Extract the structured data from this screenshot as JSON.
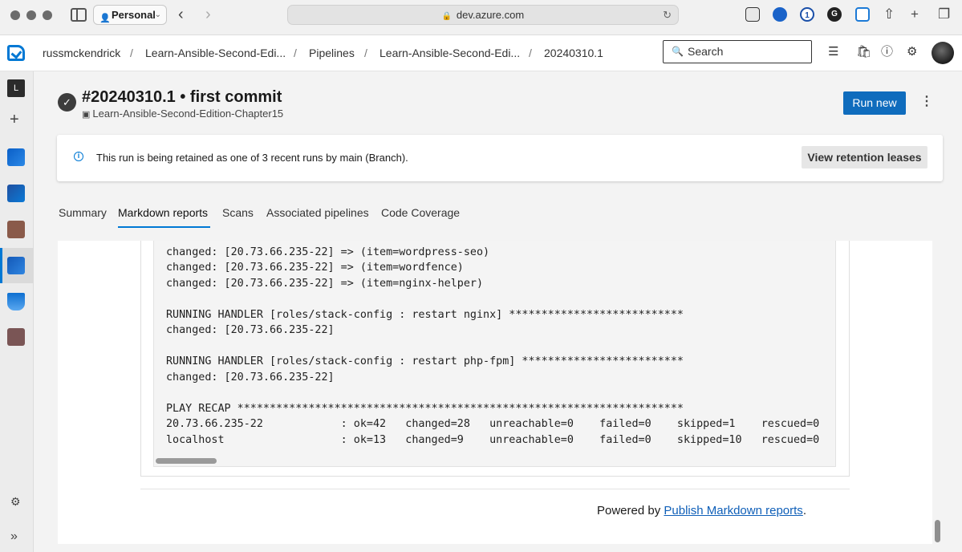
{
  "browser": {
    "profile": "Personal",
    "url": "dev.azure.com"
  },
  "header": {
    "breadcrumbs": [
      "russmckendrick",
      "Learn-Ansible-Second-Edi...",
      "Pipelines",
      "Learn-Ansible-Second-Edi...",
      "20240310.1"
    ],
    "separator": "/",
    "search_placeholder": "Search"
  },
  "left_nav": {
    "org_initial": "L"
  },
  "run": {
    "title": "#20240310.1 • first commit",
    "repo": "Learn-Ansible-Second-Edition-Chapter15",
    "run_new_label": "Run new"
  },
  "banner": {
    "message": "This run is being retained as one of 3 recent runs by main (Branch).",
    "button_label": "View retention leases"
  },
  "tabs": [
    "Summary",
    "Markdown reports",
    "Scans",
    "Associated pipelines",
    "Code Coverage"
  ],
  "active_tab": "Markdown reports",
  "report": {
    "lines": [
      "changed: [20.73.66.235-22] => (item=wordpress-seo)",
      "changed: [20.73.66.235-22] => (item=wordfence)",
      "changed: [20.73.66.235-22] => (item=nginx-helper)",
      "",
      "RUNNING HANDLER [roles/stack-config : restart nginx] ***************************",
      "changed: [20.73.66.235-22]",
      "",
      "RUNNING HANDLER [roles/stack-config : restart php-fpm] *************************",
      "changed: [20.73.66.235-22]",
      "",
      "PLAY RECAP *********************************************************************",
      "20.73.66.235-22            : ok=42   changed=28   unreachable=0    failed=0    skipped=1    rescued=0",
      "localhost                  : ok=13   changed=9    unreachable=0    failed=0    skipped=10   rescued=0"
    ],
    "footer_prefix": "Powered by ",
    "footer_link": "Publish Markdown reports",
    "footer_suffix": "."
  },
  "colors": {
    "accent": "#0078d4",
    "primary_button": "#0f6cbd"
  }
}
